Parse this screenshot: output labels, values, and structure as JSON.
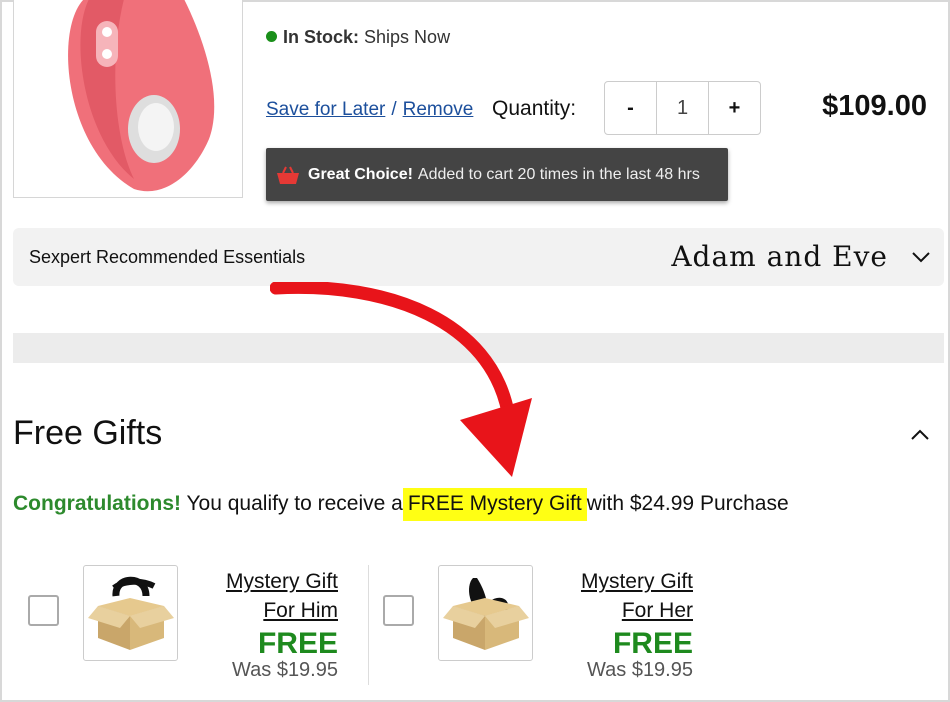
{
  "product": {
    "stock_label": "In Stock:",
    "stock_status": "Ships Now",
    "save_for_later": "Save for Later",
    "separator": "/",
    "remove": "Remove",
    "quantity_label": "Quantity:",
    "qty_minus": "-",
    "qty_value": "1",
    "qty_plus": "+",
    "price": "$109.00",
    "toast_bold": "Great Choice!",
    "toast_text": "Added to cart 20 times in the last 48 hrs"
  },
  "essentials": {
    "label": "Sexpert Recommended Essentials",
    "brand": "Adam and Eve"
  },
  "free_gifts": {
    "title": "Free Gifts",
    "congrats": "Congratulations!",
    "qualify_text": "You qualify to receive a",
    "highlight": "FREE Mystery Gift",
    "suffix": "with $24.99 Purchase",
    "items": [
      {
        "name_line1": "Mystery Gift",
        "name_line2": "For Him",
        "price": "FREE",
        "was": "Was $19.95"
      },
      {
        "name_line1": "Mystery Gift",
        "name_line2": "For Her",
        "price": "FREE",
        "was": "Was $19.95"
      }
    ]
  },
  "colors": {
    "accent_green": "#2d8a2d",
    "link_blue": "#1c4f9c",
    "highlight_yellow": "#ffff14",
    "arrow_red": "#e8141a"
  }
}
